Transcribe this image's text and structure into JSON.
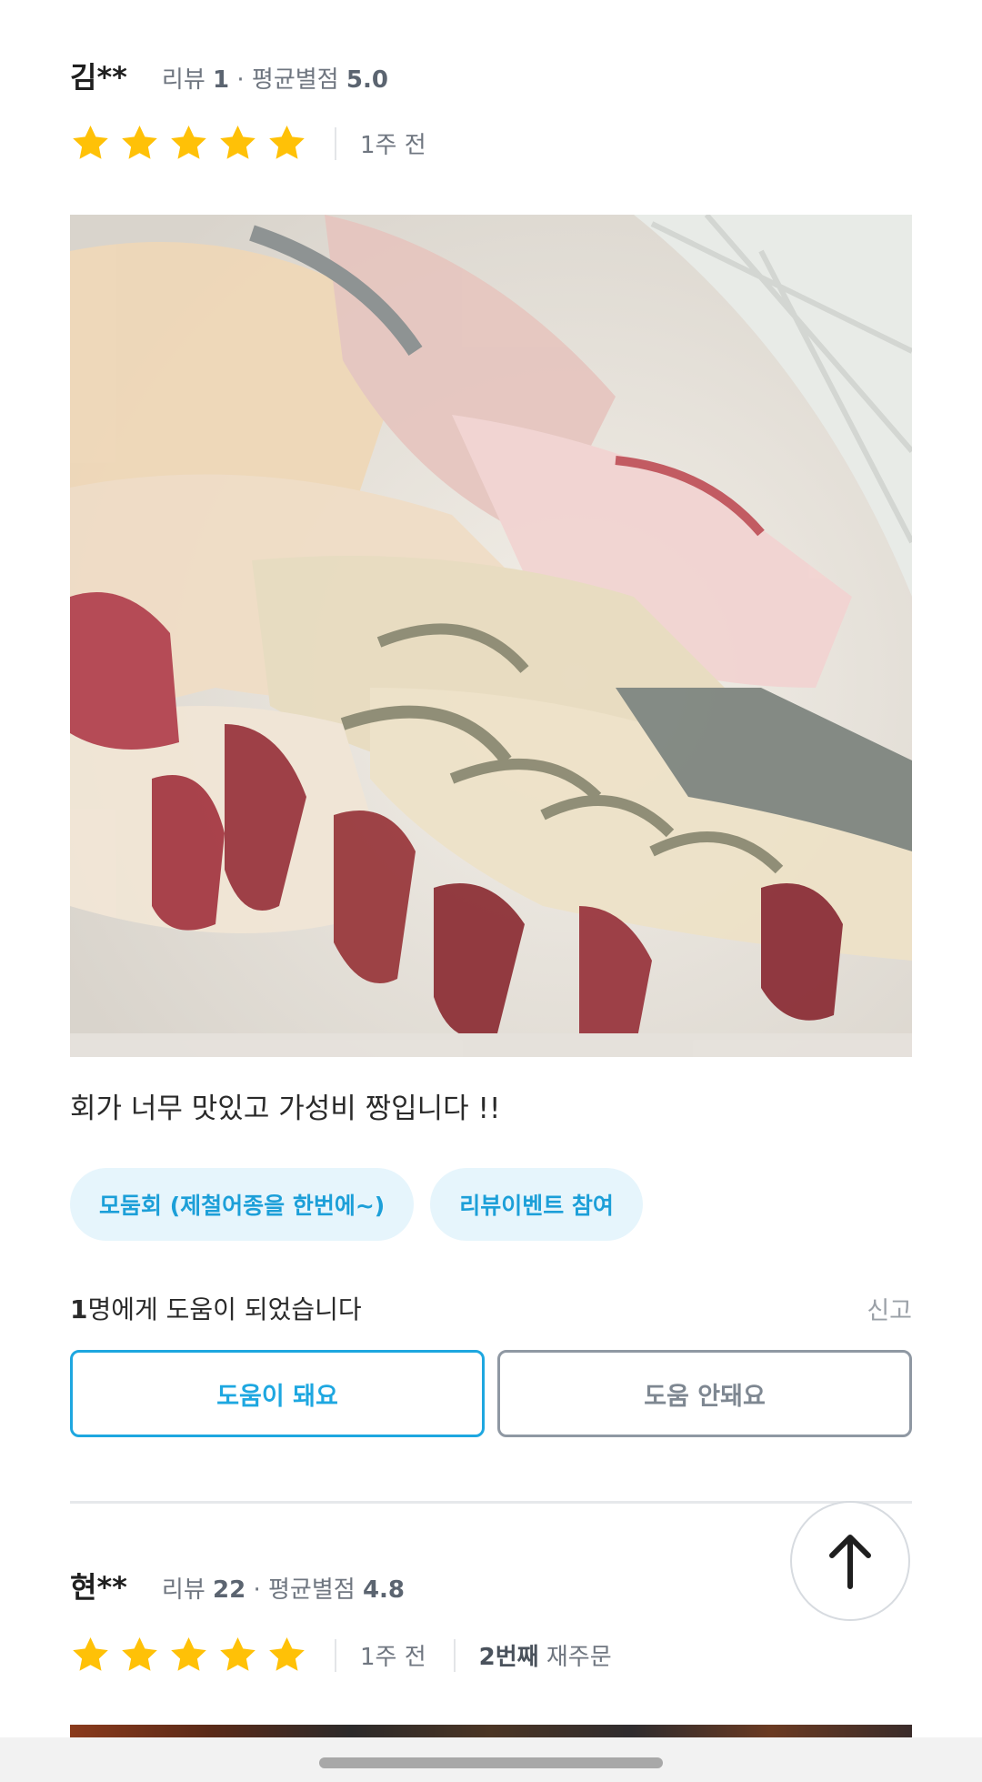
{
  "reviews": [
    {
      "author": "김**",
      "review_count_label": "리뷰",
      "review_count": "1",
      "avg_label": "평균별점",
      "avg_score": "5.0",
      "stars": 5,
      "time": "1주 전",
      "photo_icon": "sashimi-photo",
      "text": "회가 너무 맛있고 가성비 짱입니다 !!",
      "tags": [
        "모둠회 (제철어종을 한번에~)",
        "리뷰이벤트 참여"
      ],
      "helpful_count": "1",
      "helpful_suffix": "명에게 도움이 되었습니다",
      "report_label": "신고",
      "helpful_button": "도움이 돼요",
      "not_helpful_button": "도움 안돼요"
    },
    {
      "author": "현**",
      "review_count_label": "리뷰",
      "review_count": "22",
      "avg_label": "평균별점",
      "avg_score": "4.8",
      "stars": 5,
      "time": "1주 전",
      "reorder_count": "2번째",
      "reorder_label": "재주문"
    }
  ],
  "colors": {
    "star": "#ffc107",
    "accent": "#1ea7e0",
    "tag_bg": "#e6f5fc"
  },
  "fab_icon": "arrow-up-icon"
}
